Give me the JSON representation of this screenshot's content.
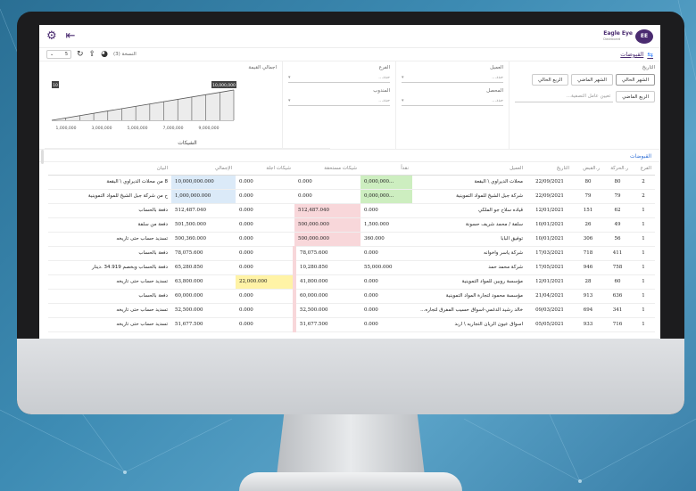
{
  "app": {
    "logo_badge": "EE",
    "logo_title": "Eagle Eye",
    "logo_sub": "Dashboard"
  },
  "breadcrumb": {
    "title": "القبوضات",
    "icon": "filter-icon"
  },
  "copy": {
    "label": "النسخة (3)",
    "page_size": "5"
  },
  "filters": {
    "date_label": "التاريخ",
    "buttons_row1": [
      "الشهر الحالي",
      "الشهر الماضي",
      "الربع الحالي"
    ],
    "buttons_row2_first": "الربع الماضي",
    "filter_placeholder": "تعيين عامل التصفية...",
    "client_label": "العميل",
    "client_placeholder": "حدد...",
    "collector_label": "المحصل",
    "collector_placeholder": "حدد...",
    "branch_label": "الفرع",
    "branch_placeholder": "حدد...",
    "rep_label": "المندوب",
    "rep_placeholder": "حدد...",
    "chart_label": "اجمالي القيمة"
  },
  "chart_data": {
    "type": "line",
    "title": "اجمالي القيمة",
    "x_ticks": [
      "1,000,000",
      "3,000,000",
      "5,000,000",
      "7,000,000",
      "9,000,000"
    ],
    "badge_low": "10",
    "badge_high": "10,000,000"
  },
  "table": {
    "tab": "القبوضات",
    "group_header": "الشيكات",
    "columns": [
      "الفرع",
      "ر.الحركة",
      "ر.القبض",
      "التاريخ",
      "العميل",
      "نقداً",
      "شيكات مستحقة",
      "شيكات اجلة",
      "الإجمالي",
      "البيان"
    ],
    "rows": [
      [
        "2",
        "80",
        "80",
        "22/09/2021",
        "محلات الديراوي \\ البقعة",
        "0,000,000...",
        "0.000",
        "0.000",
        "10,000,000.000",
        "8 من محلات الديراوي \\ البقعة"
      ],
      [
        "2",
        "79",
        "79",
        "22/09/2021",
        "شركة جبل الشيخ للمواد التموينية",
        "0,000,000...",
        "0.000",
        "0.000",
        "1,000,000.000",
        "ح من شركة جبل الشيخ للمواد التموينية"
      ],
      [
        "1",
        "62",
        "151",
        "12/01/2021",
        "قياده سلاح جو الملكي",
        "0.000",
        "512,487.040",
        "0.000",
        "512,487.040",
        "دفعة بالحساب"
      ],
      [
        "1",
        "49",
        "26",
        "10/01/2021",
        "سلفة / محمد شريف حسونة",
        "1,500.000",
        "500,000.000",
        "0.000",
        "501,500.000",
        "دفعة من سلفة"
      ],
      [
        "1",
        "56",
        "306",
        "10/01/2021",
        "توفيق البابا",
        "360.000",
        "500,000.000",
        "0.000",
        "500,360.000",
        "تسديد حساب حتى تاريخه"
      ],
      [
        "1",
        "411",
        "718",
        "17/03/2021",
        "شركة ياسر واخوانه",
        "0.000",
        "78,075.600",
        "0.000",
        "78,075.600",
        "دفعة بالحساب"
      ],
      [
        "1",
        "758",
        "946",
        "17/05/2021",
        "شركة محمد حمد",
        "55,000.000",
        "10,280.850",
        "0.000",
        "65,280.850",
        "دفعة بالحساب وبخصم 34.919 .دينار"
      ],
      [
        "1",
        "60",
        "28",
        "12/01/2021",
        "مؤسسة روبين للمواد التموينية",
        "0.000",
        "41,800.000",
        "22,000.000",
        "63,800.000",
        "تسديد حساب حتى تاريخه"
      ],
      [
        "1",
        "636",
        "913",
        "21/04/2021",
        "مؤسسة محمود لتجارة المواد التموينية",
        "0.000",
        "60,000.000",
        "0.000",
        "60,000.000",
        "دفعة بالحساب"
      ],
      [
        "1",
        "341",
        "694",
        "09/03/2021",
        "خالد رشيد الدغمي-اسواق حسيب المفرق لتجاره...",
        "0.000",
        "52,500.000",
        "0.000",
        "52,500.000",
        "تسديد حساب حتى تاريخه"
      ],
      [
        "1",
        "716",
        "933",
        "05/05/2021",
        "اسواق عيون الريان التجاريه \\ اربد",
        "0.000",
        "51,677.500",
        "0.000",
        "51,677.500",
        "تسديد حساب حتى تاريخه"
      ]
    ]
  }
}
